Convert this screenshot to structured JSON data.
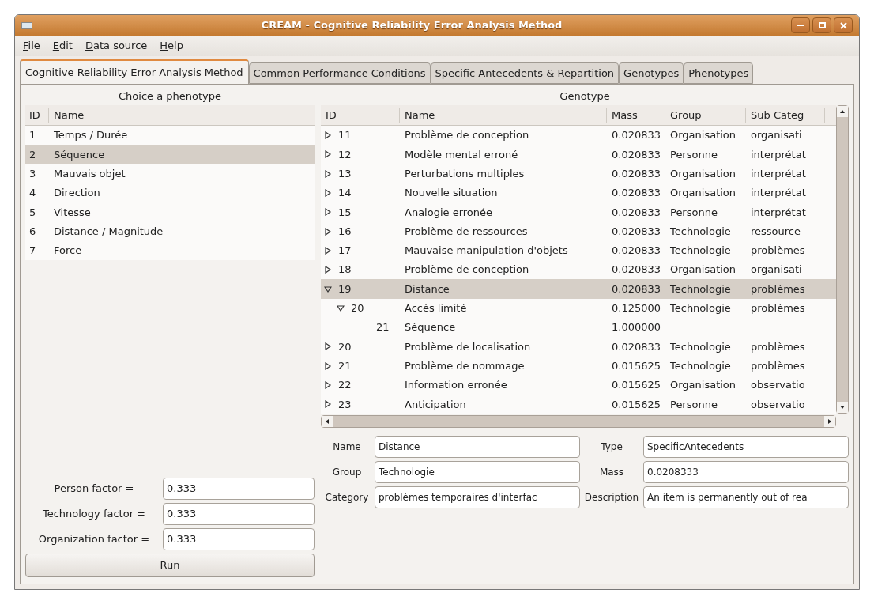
{
  "window": {
    "title": "CREAM - Cognitive Reliability Error Analysis Method"
  },
  "menu": [
    "File",
    "Edit",
    "Data source",
    "Help"
  ],
  "tabs": [
    {
      "label": "Cognitive Reliability Error Analysis Method",
      "selected": true
    },
    {
      "label": "Common Performance Conditions",
      "selected": false
    },
    {
      "label": "Specific Antecedents & Repartition",
      "selected": false
    },
    {
      "label": "Genotypes",
      "selected": false
    },
    {
      "label": "Phenotypes",
      "selected": false
    }
  ],
  "phenotype_panel": {
    "title": "Choice a phenotype",
    "columns": [
      "ID",
      "Name"
    ],
    "rows": [
      {
        "id": "1",
        "name": "Temps / Durée",
        "selected": false
      },
      {
        "id": "2",
        "name": "Séquence",
        "selected": true
      },
      {
        "id": "3",
        "name": "Mauvais objet",
        "selected": false
      },
      {
        "id": "4",
        "name": "Direction",
        "selected": false
      },
      {
        "id": "5",
        "name": "Vitesse",
        "selected": false
      },
      {
        "id": "6",
        "name": "Distance / Magnitude",
        "selected": false
      },
      {
        "id": "7",
        "name": "Force",
        "selected": false
      }
    ]
  },
  "factors": [
    {
      "label": "Person factor =",
      "value": "0.333"
    },
    {
      "label": "Technology factor =",
      "value": "0.333"
    },
    {
      "label": "Organization factor =",
      "value": "0.333"
    }
  ],
  "run_button": "Run",
  "genotype_panel": {
    "title": "Genotype",
    "columns": [
      "ID",
      "Name",
      "Mass",
      "Group",
      "Sub Categ"
    ],
    "rows": [
      {
        "id": "11",
        "name": "Problème de conception",
        "mass": "0.020833",
        "group": "Organisation",
        "sub_category": "organisati",
        "expanded": false,
        "selected": false
      },
      {
        "id": "12",
        "name": "Modèle mental erroné",
        "mass": "0.020833",
        "group": "Personne",
        "sub_category": "interprétat",
        "expanded": false,
        "selected": false
      },
      {
        "id": "13",
        "name": "Perturbations multiples",
        "mass": "0.020833",
        "group": "Organisation",
        "sub_category": "interprétat",
        "expanded": false,
        "selected": false
      },
      {
        "id": "14",
        "name": "Nouvelle situation",
        "mass": "0.020833",
        "group": "Organisation",
        "sub_category": "interprétat",
        "expanded": false,
        "selected": false
      },
      {
        "id": "15",
        "name": "Analogie erronée",
        "mass": "0.020833",
        "group": "Personne",
        "sub_category": "interprétat",
        "expanded": false,
        "selected": false
      },
      {
        "id": "16",
        "name": "Problème de ressources",
        "mass": "0.020833",
        "group": "Technologie",
        "sub_category": "ressource",
        "expanded": false,
        "selected": false
      },
      {
        "id": "17",
        "name": "Mauvaise manipulation d'objets",
        "mass": "0.020833",
        "group": "Technologie",
        "sub_category": "problèmes",
        "expanded": false,
        "selected": false
      },
      {
        "id": "18",
        "name": "Problème de conception",
        "mass": "0.020833",
        "group": "Organisation",
        "sub_category": "organisati",
        "expanded": false,
        "selected": false
      },
      {
        "id": "19",
        "name": "Distance",
        "mass": "0.020833",
        "group": "Technologie",
        "sub_category": "problèmes",
        "expanded": true,
        "selected": true,
        "children": [
          {
            "id": "20",
            "name": "Accès limité",
            "mass": "0.125000",
            "group": "Technologie",
            "sub_category": "problèmes",
            "expanded": true,
            "selected": false,
            "children": [
              {
                "id": "21",
                "name": "Séquence",
                "mass": "1.000000",
                "selected": false
              }
            ]
          }
        ]
      },
      {
        "id": "20",
        "name": "Problème de localisation",
        "mass": "0.020833",
        "group": "Technologie",
        "sub_category": "problèmes",
        "expanded": false,
        "selected": false
      },
      {
        "id": "21",
        "name": "Problème de nommage",
        "mass": "0.015625",
        "group": "Technologie",
        "sub_category": "problèmes",
        "expanded": false,
        "selected": false
      },
      {
        "id": "22",
        "name": "Information erronée",
        "mass": "0.015625",
        "group": "Organisation",
        "sub_category": "observatio",
        "expanded": false,
        "selected": false
      },
      {
        "id": "23",
        "name": "Anticipation",
        "mass": "0.015625",
        "group": "Personne",
        "sub_category": "observatio",
        "expanded": false,
        "selected": false
      }
    ]
  },
  "details": [
    {
      "label": "Name",
      "value": "Distance"
    },
    {
      "label": "Type",
      "value": "SpecificAntecedents"
    },
    {
      "label": "Group",
      "value": "Technologie"
    },
    {
      "label": "Mass",
      "value": "0.0208333"
    },
    {
      "label": "Category",
      "value": "problèmes temporaires d'interfac"
    },
    {
      "label": "Description",
      "value": "An item is permanently out of rea"
    }
  ]
}
